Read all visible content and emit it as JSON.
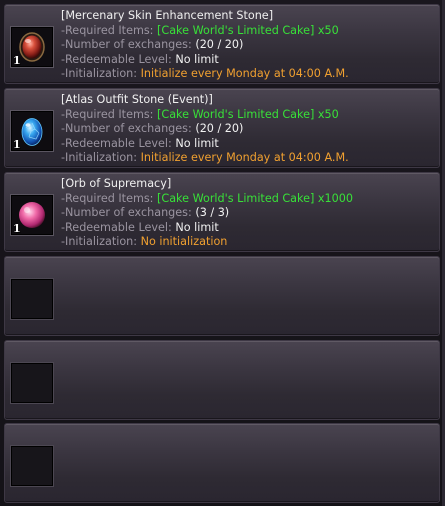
{
  "items": [
    {
      "title": "[Mercenary Skin Enhancement Stone]",
      "quantity": "1",
      "icon": "red-gem-icon",
      "required_label": "-Required Items:",
      "required_value": "[Cake World's Limited Cake] x50",
      "exchanges_label": "-Number of exchanges:",
      "exchanges_value": "(20 / 20)",
      "level_label": "-Redeemable Level:",
      "level_value": "No limit",
      "init_label": "-Initialization:",
      "init_value": "Initialize every Monday at 04:00 A.M."
    },
    {
      "title": "[Atlas Outfit Stone (Event)]",
      "quantity": "1",
      "icon": "blue-crystal-egg-icon",
      "required_label": "-Required Items:",
      "required_value": "[Cake World's Limited Cake] x50",
      "exchanges_label": "-Number of exchanges:",
      "exchanges_value": "(20 / 20)",
      "level_label": "-Redeemable Level:",
      "level_value": "No limit",
      "init_label": "-Initialization:",
      "init_value": "Initialize every Monday at 04:00 A.M."
    },
    {
      "title": "[Orb of Supremacy]",
      "quantity": "1",
      "icon": "pink-orb-icon",
      "required_label": "-Required Items:",
      "required_value": "[Cake World's Limited Cake] x1000",
      "exchanges_label": "-Number of exchanges:",
      "exchanges_value": "(3 / 3)",
      "level_label": "-Redeemable Level:",
      "level_value": "No limit",
      "init_label": "-Initialization:",
      "init_value": "No initialization"
    }
  ],
  "empty_slots": 3,
  "colors": {
    "required": "#38e038",
    "initialization": "#f0a030",
    "label": "#9a94a0",
    "title": "#f0f0f0"
  }
}
